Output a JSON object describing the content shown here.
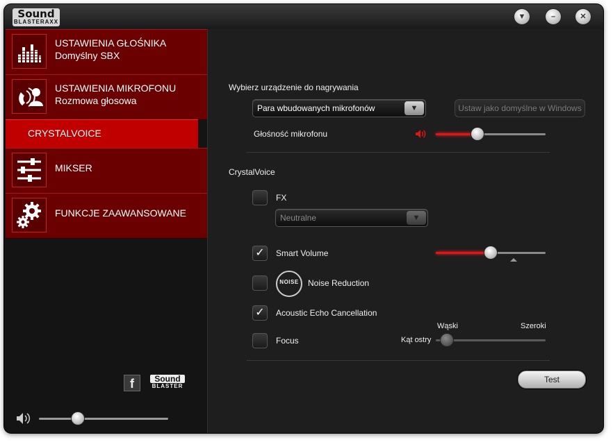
{
  "app": {
    "logo_line1": "Sound",
    "logo_line2": "BLASTERAXX"
  },
  "titlebar": {
    "buttons": [
      "▼",
      "–",
      "✕"
    ]
  },
  "sidebar": {
    "items": [
      {
        "title": "USTAWIENIA GŁOŚNIKA",
        "subtitle": "Domyślny SBX",
        "icon": "equalizer-icon"
      },
      {
        "title": "USTAWIENIA MIKROFONU",
        "subtitle": "Rozmowa głosowa",
        "icon": "microphone-user-icon"
      },
      {
        "title": "CRYSTALVOICE",
        "active": true
      },
      {
        "title": "MIKSER",
        "icon": "mixer-sliders-icon"
      },
      {
        "title": "FUNKCJE ZAAWANSOWANE",
        "icon": "gears-icon"
      }
    ],
    "facebook_glyph": "f",
    "brand_line1": "Sound",
    "brand_line2": "BLASTER",
    "master_volume": 0.3
  },
  "recording": {
    "heading": "Wybierz urządzenie do nagrywania",
    "device_selected": "Para wbudowanych mikrofonów",
    "set_default_label": "Ustaw jako domyślne w Windows",
    "mic_volume_label": "Głośność mikrofonu",
    "mic_volume": 0.38
  },
  "crystalvoice": {
    "heading": "CrystalVoice",
    "fx_label": "FX",
    "fx_checked": false,
    "fx_preset": "Neutralne",
    "smart_volume_label": "Smart Volume",
    "smart_volume_checked": true,
    "smart_volume_level": 0.5,
    "noise_logo": "NOISE",
    "noise_reduction_label": "Noise Reduction",
    "noise_reduction_checked": false,
    "aec_label": "Acoustic Echo Cancellation",
    "aec_checked": true,
    "focus_label": "Focus",
    "focus_checked": false,
    "focus_narrow_label": "Wąski",
    "focus_wide_label": "Szeroki",
    "focus_angle_label": "Kąt ostry",
    "focus_level": 0.1,
    "check_glyph": "✓"
  },
  "test_label": "Test",
  "colors": {
    "accent": "#c00000",
    "accent_dark": "#6a0000",
    "slider_fill": "#e01515"
  }
}
